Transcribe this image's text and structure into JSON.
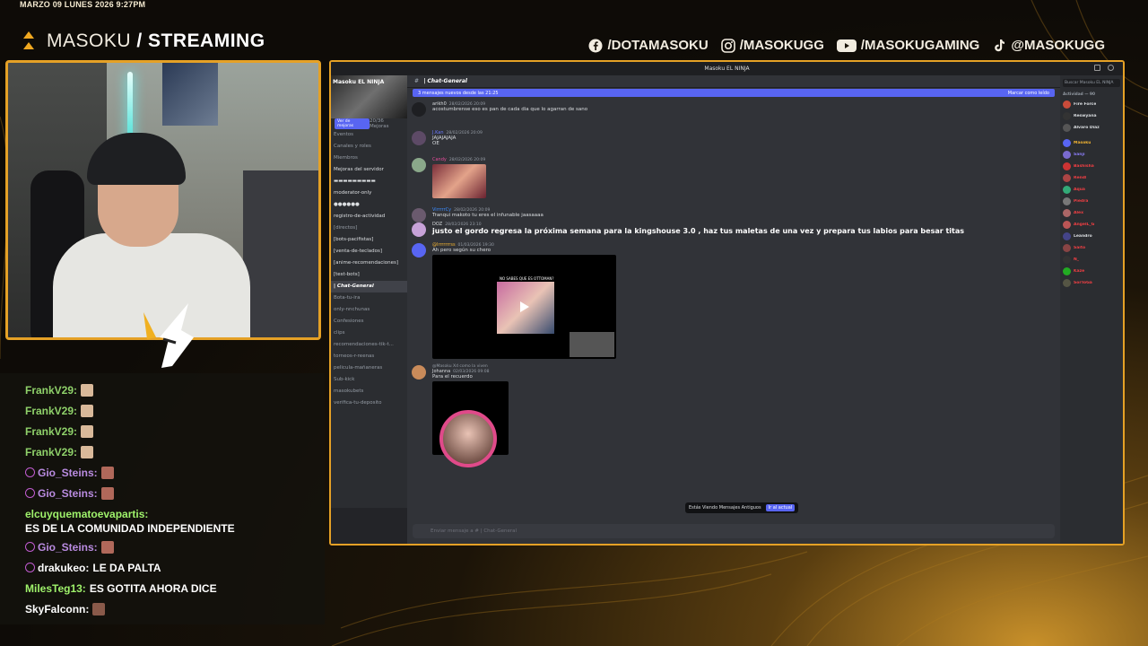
{
  "datetime": "MARZO 09 LUNES 2026 9:27PM",
  "brand": {
    "light": "MASOKU",
    "slash": " / ",
    "bold": "STREAMING"
  },
  "socials": [
    {
      "icon": "facebook-icon",
      "handle": "/DOTAMASOKU"
    },
    {
      "icon": "instagram-icon",
      "handle": "/MASOKUGG"
    },
    {
      "icon": "youtube-icon",
      "handle": "/MASOKUGAMING"
    },
    {
      "icon": "tiktok-icon",
      "handle": "@MASOKUGG"
    }
  ],
  "chat": [
    {
      "user": "FrankV29:",
      "color": "#8fd16a",
      "text": "",
      "emote": "#d9b99a",
      "badge": false
    },
    {
      "user": "FrankV29:",
      "color": "#8fd16a",
      "text": "",
      "emote": "#d9b99a",
      "badge": false
    },
    {
      "user": "FrankV29:",
      "color": "#8fd16a",
      "text": "",
      "emote": "#d9b99a",
      "badge": false
    },
    {
      "user": "FrankV29:",
      "color": "#8fd16a",
      "text": "",
      "emote": "#d9b99a",
      "badge": false
    },
    {
      "user": "Gio_Steins:",
      "color": "#b98be0",
      "text": "",
      "emote": "#b0685a",
      "badge": true
    },
    {
      "user": "Gio_Steins:",
      "color": "#b98be0",
      "text": "",
      "emote": "#b0685a",
      "badge": true
    },
    {
      "user": "elcuyquematoevapartis:",
      "color": "#9ff26b",
      "text": "ES DE LA COMUNIDAD INDEPENDIENTE",
      "emote": "",
      "badge": false
    },
    {
      "user": "Gio_Steins:",
      "color": "#b98be0",
      "text": "",
      "emote": "#b0685a",
      "badge": true
    },
    {
      "user": "drakukeo:",
      "color": "#ffffff",
      "text": "LE DA PALTA",
      "emote": "",
      "badge": true
    },
    {
      "user": "MilesTeg13:",
      "color": "#9ff26b",
      "text": "ES GOTITA AHORA DICE",
      "emote": "",
      "badge": false
    },
    {
      "user": "SkyFalconn:",
      "color": "#ffffff",
      "text": "",
      "emote": "#8a5a4a",
      "badge": false
    }
  ],
  "discord": {
    "window_title": "Masoku EL NINJA",
    "server_name": "Masoku EL NINJA",
    "boost_label": "Ver de mejoras",
    "boost_count": "20/36 Mejoras",
    "channels": [
      {
        "name": "Eventos",
        "state": "normal"
      },
      {
        "name": "Canales y roles",
        "state": "normal"
      },
      {
        "name": "Miembros",
        "state": "normal"
      },
      {
        "name": "Mejoras del servidor",
        "state": "bright"
      },
      {
        "name": "▬▬▬▬▬▬▬▬▬",
        "state": "bright"
      },
      {
        "name": "moderator-only",
        "state": "bright"
      },
      {
        "name": "●●●●●●",
        "state": "bright"
      },
      {
        "name": "registro-de-actividad",
        "state": "bright"
      },
      {
        "name": "[directos]",
        "state": "normal"
      },
      {
        "name": "[bots-pacifistas]",
        "state": "bright"
      },
      {
        "name": "[venta-de-teclados]",
        "state": "bright"
      },
      {
        "name": "[anime-recomendaciones]",
        "state": "bright"
      },
      {
        "name": "[test-bots]",
        "state": "bright"
      },
      {
        "name": "| Chat-General",
        "state": "sel"
      },
      {
        "name": "Bota-tu-ira",
        "state": "normal"
      },
      {
        "name": "only-nnchunas",
        "state": "normal"
      },
      {
        "name": "Confesiones",
        "state": "normal"
      },
      {
        "name": "clips",
        "state": "normal"
      },
      {
        "name": "recomendaciones-tik-t...",
        "state": "normal"
      },
      {
        "name": "torneos-r-reenas",
        "state": "normal"
      },
      {
        "name": "pelicula-mañaneras",
        "state": "normal"
      },
      {
        "name": "Sub-kick",
        "state": "normal"
      },
      {
        "name": "masokubets",
        "state": "normal"
      },
      {
        "name": "verifica-tu-deposito",
        "state": "normal"
      }
    ],
    "channel_title": "| Chat-General",
    "new_messages": "3 mensajes nuevos desde las 21:25",
    "mark_read": "Marcar como leído",
    "messages": [
      {
        "name": "arikh0",
        "name_color": "#dbdee1",
        "time": "28/02/2026 20:09",
        "text": "acostumbrense eso es pan de cada dia que lo agarran de sano",
        "avatar": "#1e1f22",
        "big": false,
        "image": ""
      },
      {
        "name": "J.Kan",
        "name_color": "#6b7bff",
        "time": "28/02/2026 20:09",
        "text": "JAJAJAJAJA",
        "avatar": "#5d4a66",
        "big": false,
        "image": ""
      },
      {
        "name": "",
        "name_color": "#dbdee1",
        "time": "",
        "text": "OE",
        "avatar": "",
        "big": false,
        "image": ""
      },
      {
        "name": "Candy",
        "name_color": "#e74c9c",
        "time": "28/02/2026 20:09",
        "text": "",
        "avatar": "#8aa88a",
        "big": false,
        "image": "selfie"
      },
      {
        "name": "VirrrrrCy",
        "name_color": "#3b8cff",
        "time": "28/02/2026 20:09",
        "text": "Tranqui makoto tu eres el infunable jaasaaaa",
        "avatar": "#6a5a6e",
        "big": false,
        "image": ""
      },
      {
        "name": "DOZ",
        "name_color": "#dbdee1",
        "time": "28/02/2026 23:10",
        "text": "justo el gordo regresa la próxima semana para la kingshouse 3.0 , haz tus maletas de una vez y prepara tus labios para besar titas",
        "avatar": "#c7a2d8",
        "big": true,
        "image": ""
      },
      {
        "name": "@Irrrrrrrss",
        "name_color": "#f0b232",
        "time": "01/03/2026 19:30",
        "text": "Ah pero según su chero",
        "avatar": "#5865f2",
        "big": false,
        "image": "video"
      },
      {
        "name": "Johanna",
        "name_color": "#dbdee1",
        "time": "02/03/2026 09:08",
        "text": "Para el recuerdo",
        "avatar": "#c98b5a",
        "big": false,
        "image": "sticker",
        "reply": "@Masoku Xd como la viven"
      }
    ],
    "video_title": "NO SABES QUE ES OTTOMAN?",
    "older_notice": "Estás Viendo Mensajes Antiguos",
    "jump_label": "Ir al actual",
    "input_placeholder": "Enviar mensaje a # | Chat-General",
    "member_search": "Buscar Masoku EL NINJA",
    "activity_label": "Actividad — 90",
    "members": [
      {
        "name": "Fire Force",
        "color": "#dbdee1",
        "avatar": "#c94b3a"
      },
      {
        "name": "Reswyana",
        "color": "#dbdee1",
        "avatar": "#333"
      },
      {
        "name": "Alvaro Diaz",
        "color": "#dbdee1",
        "avatar": "#555"
      },
      {
        "name": "Masoku",
        "color": "#f0b232",
        "avatar": "#5865f2"
      },
      {
        "name": "Sanji",
        "color": "#8a7cf5",
        "avatar": "#7a6acf"
      },
      {
        "name": "Bashisha",
        "color": "#f23f43",
        "avatar": "#c33"
      },
      {
        "name": "Rendl",
        "color": "#f23f43",
        "avatar": "#a44"
      },
      {
        "name": "Aqua",
        "color": "#f23f43",
        "avatar": "#3a7"
      },
      {
        "name": "Piedra",
        "color": "#f23f43",
        "avatar": "#777"
      },
      {
        "name": "Alex",
        "color": "#f23f43",
        "avatar": "#a66"
      },
      {
        "name": "AngelL_G",
        "color": "#f23f43",
        "avatar": "#b55"
      },
      {
        "name": "Leandro",
        "color": "#dbdee1",
        "avatar": "#448"
      },
      {
        "name": "Saito",
        "color": "#f23f43",
        "avatar": "#844"
      },
      {
        "name": "N_",
        "color": "#f23f43",
        "avatar": "#333"
      },
      {
        "name": "Kaze",
        "color": "#f23f43",
        "avatar": "#2a2"
      },
      {
        "name": "SorToGa",
        "color": "#f23f43",
        "avatar": "#554"
      }
    ]
  }
}
